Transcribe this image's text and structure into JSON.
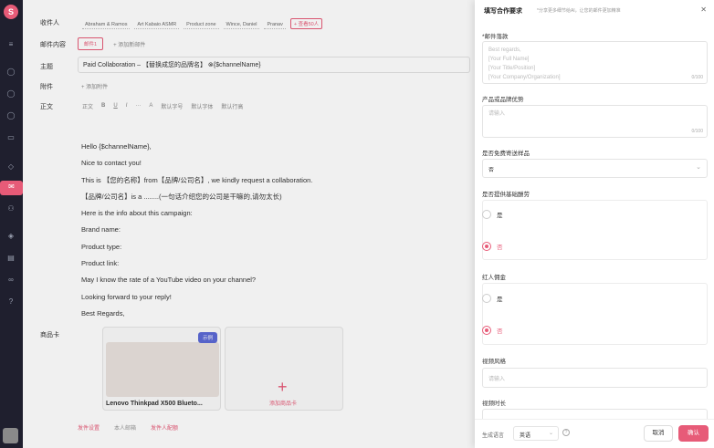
{
  "nav": {
    "logo": "S"
  },
  "form": {
    "recipient_label": "收件人",
    "recipients": [
      "Abraham & Ramos",
      "Art Kabaio ASMR",
      "Product zone",
      "Wince, Daniel",
      "Pranav"
    ],
    "add_recipient": "+ 查看50人",
    "content_label": "邮件内容",
    "mail_tab": "邮件1",
    "add_mail": "添加新邮件",
    "subject_label": "主题",
    "subject_value": "Paid Collaboration – 【替换成您的品牌名】 ⊗{$channelName}",
    "attach_label": "附件",
    "attach_btn": "+ 添加附件",
    "body_label": "正文",
    "toolbar": [
      "正文",
      "B",
      "U",
      "I",
      "···",
      "A",
      "默认字号",
      "默认字体",
      "默认行高"
    ],
    "body_lines": [
      "Hello {$channelName},",
      "Nice to contact you!",
      "This is 【您的名称】from【品牌/公司名】, we kindly request a collaboration.",
      "【品牌/公司名】is a ........(一句话介绍您的公司是干嘛的,请勿太长)",
      "Here is the info about this campaign:",
      "Brand name:",
      "Product type:",
      "Product link:",
      "May I know the rate of a YouTube video on your channel?",
      "Looking forward to your reply!",
      "Best Regards,"
    ],
    "product_label": "商品卡",
    "product_name": "Lenovo Thinkpad X500 Blueto...",
    "product_badge": "示例",
    "add_card": "添加商品卡",
    "footer": [
      "发件设置",
      "本人邮箱",
      "发件人配额"
    ]
  },
  "drawer": {
    "title": "填写合作要求",
    "subtitle": "*分享更多细节给AI，让您的邮件更加精准",
    "signature_label": "*邮件落款",
    "signature_placeholder": "Best regards,\n[Your Full Name]\n[Your Title/Position]\n[Your Company/Organization]",
    "signature_count": "0/100",
    "product_adv_label": "产品或品牌优势",
    "product_adv_placeholder": "请输入",
    "product_adv_count": "0/100",
    "free_sample_label": "是否免费寄送样品",
    "free_sample_value": "否",
    "base_fee_label": "是否提供基础酬劳",
    "base_fee_options": [
      "是",
      "否"
    ],
    "base_fee_selected": 1,
    "commission_label": "红人佣金",
    "commission_options": [
      "是",
      "否"
    ],
    "commission_selected": 1,
    "video_style_label": "视频风格",
    "video_style_placeholder": "请输入",
    "video_length_label": "视频时长",
    "lang_label": "生成语言",
    "lang_value": "英语",
    "cancel": "取消",
    "confirm": "确认"
  },
  "colors": {
    "accent": "#e75b78",
    "nav_bg": "#1f1f2e"
  }
}
